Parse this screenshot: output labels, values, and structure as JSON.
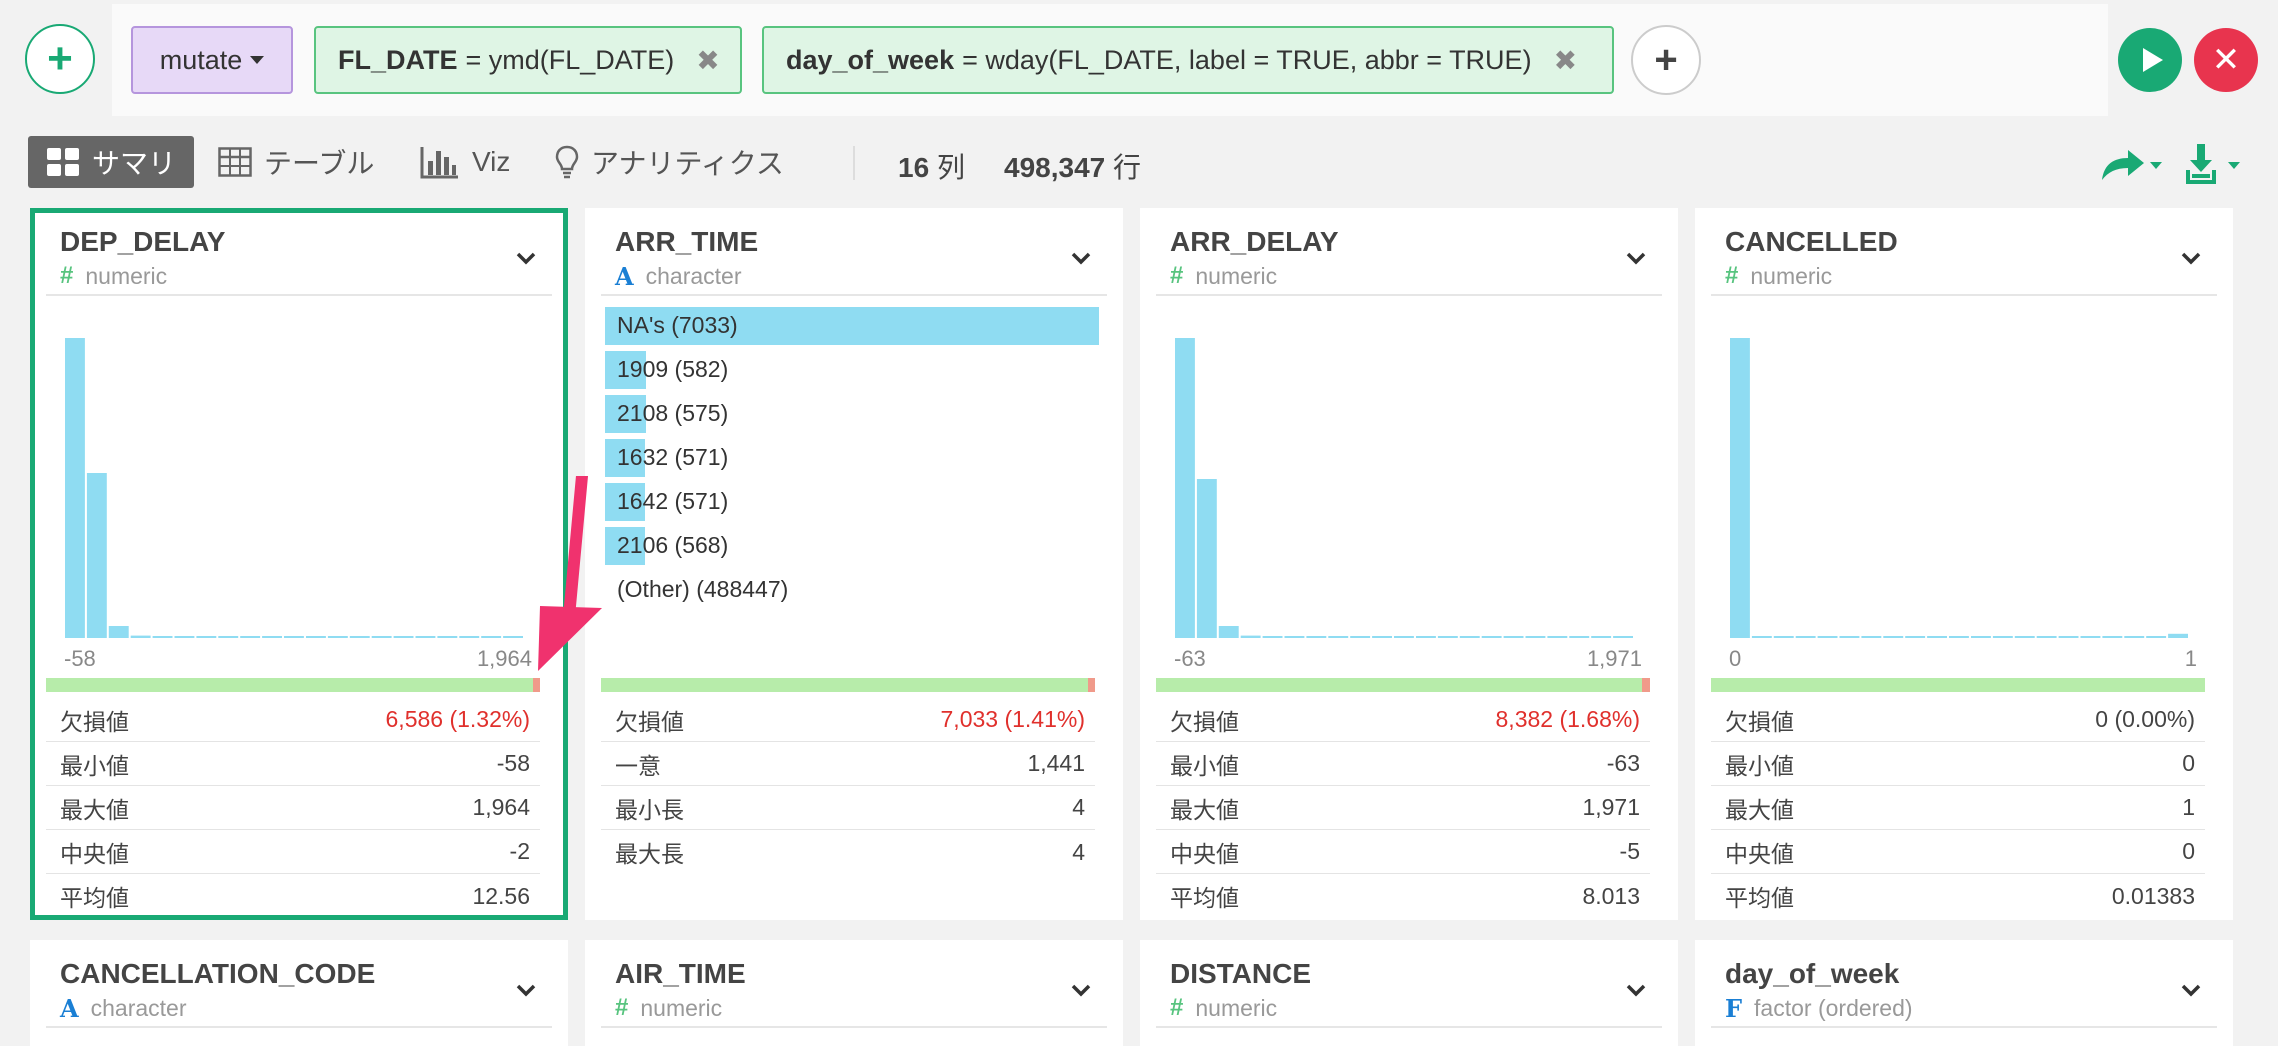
{
  "toolbar": {
    "command_label": "mutate",
    "tokens": [
      {
        "name": "FL_DATE",
        "expr": "= ymd(FL_DATE)"
      },
      {
        "name": "day_of_week",
        "expr": "= wday(FL_DATE, label = TRUE, abbr = TRUE)"
      }
    ],
    "icons": {
      "add": "plus-icon",
      "run": "play-icon",
      "cancel": "x-icon"
    },
    "colors": {
      "run": "#19a974",
      "cancel": "#e8344e",
      "command": "#e7d9f7",
      "token": "#dff5e5"
    }
  },
  "tabs": {
    "summary": "サマリ",
    "table": "テーブル",
    "viz": "Viz",
    "analytics": "アナリティクス",
    "col_count": "16",
    "col_unit": "列",
    "row_count": "498,347",
    "row_unit": "行"
  },
  "cards": [
    {
      "name": "DEP_DELAY",
      "type": "numeric",
      "kind": "numeric",
      "axis_min": "-58",
      "axis_max": "1,964",
      "hist": [
        1.0,
        0.55,
        0.04,
        0.008,
        0.006,
        0.005,
        0.005,
        0.004,
        0.004,
        0.004,
        0.004,
        0.003,
        0.003,
        0.003,
        0.003,
        0.003,
        0.003,
        0.003,
        0.003,
        0.003,
        0.003
      ],
      "missing_fraction": 0.0132,
      "stats": [
        {
          "label": "欠損値",
          "value": "6,586 (1.32%)",
          "alert": true
        },
        {
          "label": "最小値",
          "value": "-58"
        },
        {
          "label": "最大値",
          "value": "1,964"
        },
        {
          "label": "中央値",
          "value": "-2"
        },
        {
          "label": "平均値",
          "value": "12.56"
        }
      ]
    },
    {
      "name": "ARR_TIME",
      "type": "character",
      "kind": "character",
      "categories": [
        {
          "label": "NA's (7033)",
          "fraction": 1.0
        },
        {
          "label": "1909 (582)",
          "fraction": 0.083
        },
        {
          "label": "2108 (575)",
          "fraction": 0.082
        },
        {
          "label": "1632 (571)",
          "fraction": 0.081
        },
        {
          "label": "1642 (571)",
          "fraction": 0.081
        },
        {
          "label": "2106 (568)",
          "fraction": 0.081
        },
        {
          "label": "(Other) (488447)",
          "fraction": 0
        }
      ],
      "missing_fraction": 0.0141,
      "stats": [
        {
          "label": "欠損値",
          "value": "7,033 (1.41%)",
          "alert": true
        },
        {
          "label": "一意",
          "value": "1,441"
        },
        {
          "label": "最小長",
          "value": "4"
        },
        {
          "label": "最大長",
          "value": "4"
        }
      ]
    },
    {
      "name": "ARR_DELAY",
      "type": "numeric",
      "kind": "numeric",
      "axis_min": "-63",
      "axis_max": "1,971",
      "hist": [
        1.0,
        0.53,
        0.04,
        0.008,
        0.006,
        0.005,
        0.005,
        0.004,
        0.004,
        0.004,
        0.004,
        0.003,
        0.003,
        0.003,
        0.003,
        0.003,
        0.003,
        0.003,
        0.003,
        0.003,
        0.003
      ],
      "missing_fraction": 0.0168,
      "stats": [
        {
          "label": "欠損値",
          "value": "8,382 (1.68%)",
          "alert": true
        },
        {
          "label": "最小値",
          "value": "-63"
        },
        {
          "label": "最大値",
          "value": "1,971"
        },
        {
          "label": "中央値",
          "value": "-5"
        },
        {
          "label": "平均値",
          "value": "8.013"
        }
      ]
    },
    {
      "name": "CANCELLED",
      "type": "numeric",
      "kind": "numeric",
      "axis_min": "0",
      "axis_max": "1",
      "hist": [
        1.0,
        0,
        0,
        0,
        0,
        0,
        0,
        0,
        0,
        0,
        0,
        0,
        0,
        0,
        0,
        0,
        0,
        0,
        0,
        0,
        0.014
      ],
      "missing_fraction": 0,
      "stats": [
        {
          "label": "欠損値",
          "value": "0 (0.00%)"
        },
        {
          "label": "最小値",
          "value": "0"
        },
        {
          "label": "最大値",
          "value": "1"
        },
        {
          "label": "中央値",
          "value": "0"
        },
        {
          "label": "平均値",
          "value": "0.01383"
        }
      ]
    },
    {
      "name": "CANCELLATION_CODE",
      "type": "character",
      "kind": "character_stub"
    },
    {
      "name": "AIR_TIME",
      "type": "numeric",
      "kind": "numeric_stub"
    },
    {
      "name": "DISTANCE",
      "type": "numeric",
      "kind": "numeric_stub"
    },
    {
      "name": "day_of_week",
      "type": "factor (ordered)",
      "kind": "factor_stub"
    }
  ],
  "colors": {
    "hist_bar": "#8fdcf2",
    "valid": "#b7ecaa",
    "missing": "#f09a8a",
    "selected": "#19a974",
    "alert": "#e0302c",
    "annotation_arrow": "#f0326e"
  }
}
